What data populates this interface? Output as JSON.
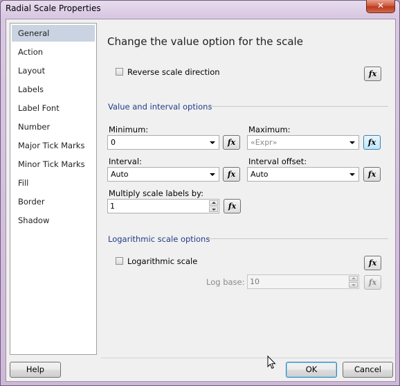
{
  "window": {
    "title": "Radial Scale Properties",
    "close_glyph": "✕"
  },
  "nav": {
    "items": [
      {
        "label": "General",
        "selected": true
      },
      {
        "label": "Action"
      },
      {
        "label": "Layout"
      },
      {
        "label": "Labels"
      },
      {
        "label": "Label Font"
      },
      {
        "label": "Number"
      },
      {
        "label": "Major Tick Marks"
      },
      {
        "label": "Minor Tick Marks"
      },
      {
        "label": "Fill"
      },
      {
        "label": "Border"
      },
      {
        "label": "Shadow"
      }
    ]
  },
  "main": {
    "heading": "Change the value option for the scale",
    "reverse_label": "Reverse scale direction",
    "reverse_checked": false,
    "value_section_title": "Value and interval options",
    "minimum_label": "Minimum:",
    "minimum_value": "0",
    "maximum_label": "Maximum:",
    "maximum_value": "«Expr»",
    "interval_label": "Interval:",
    "interval_value": "Auto",
    "interval_offset_label": "Interval offset:",
    "interval_offset_value": "Auto",
    "multiply_label": "Multiply scale labels by:",
    "multiply_value": "1",
    "log_section_title": "Logarithmic scale options",
    "log_label": "Logarithmic scale",
    "log_checked": false,
    "log_base_label": "Log base:",
    "log_base_value": "10",
    "fx_text": "fx"
  },
  "footer": {
    "help_label": "Help",
    "ok_label": "OK",
    "cancel_label": "Cancel"
  },
  "colors": {
    "section_title": "#1f3c88",
    "selected_nav": "#c9d3e1",
    "focus_border": "#3c7fb1"
  }
}
